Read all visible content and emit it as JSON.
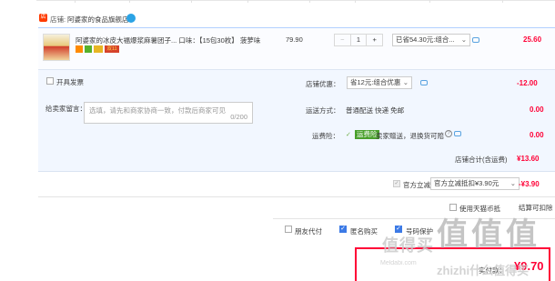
{
  "store": {
    "prefix": "店铺:",
    "name": "阿婆家的食品旗舰店"
  },
  "item": {
    "title": "阿婆家的冰皮大福爆浆麻薯团子...  口味：【15包30枚】 菠萝味",
    "badge_gold": "双11",
    "unit_price": "79.90",
    "quantity": "1",
    "minus": "−",
    "plus": "+",
    "promo_selected": "已省54.30元:组合...",
    "total": "25.60"
  },
  "options": {
    "invoice_label": "开具发票",
    "memo_label": "给卖家留言：",
    "memo_placeholder": "选填，请先和商家协商一致，付款后商家可见",
    "memo_count": "0/200",
    "coupon_label": "店铺优惠：",
    "coupon_selected": "省12元:组合优惠",
    "coupon_discount": "-12.00",
    "shipping_label": "运送方式：",
    "shipping_value": "普通配送 快递 免邮",
    "shipping_cost": "0.00",
    "insurance_label": "运费险：",
    "insurance_tag": "运费险",
    "insurance_text": "卖家赠送，退换货可赔",
    "insurance_cost": "0.00",
    "store_total_label": "店铺合计(含运费)",
    "store_total_value": "¥13.60"
  },
  "tmall": {
    "label": "官方立减",
    "selected": "官方立减抵扣¥3.90元",
    "discount": "-¥3.90"
  },
  "tmall_coin": {
    "label": "使用天猫币抵",
    "extra": "结算可扣除"
  },
  "checkout_options": {
    "anonymous_friend": "朋友代付",
    "anonymous_buy": "匿名购买",
    "other": "号码保护"
  },
  "payment": {
    "label": "实付款：",
    "amount": "¥9.70"
  },
  "watermark": {
    "cn": "值得买",
    "host": "zhizhi什么值得买",
    "domain": "Meldabi.com"
  },
  "colors": {
    "accent_red": "#ff0036",
    "blue": "#3c7ae6",
    "green": "#4aa02c"
  }
}
